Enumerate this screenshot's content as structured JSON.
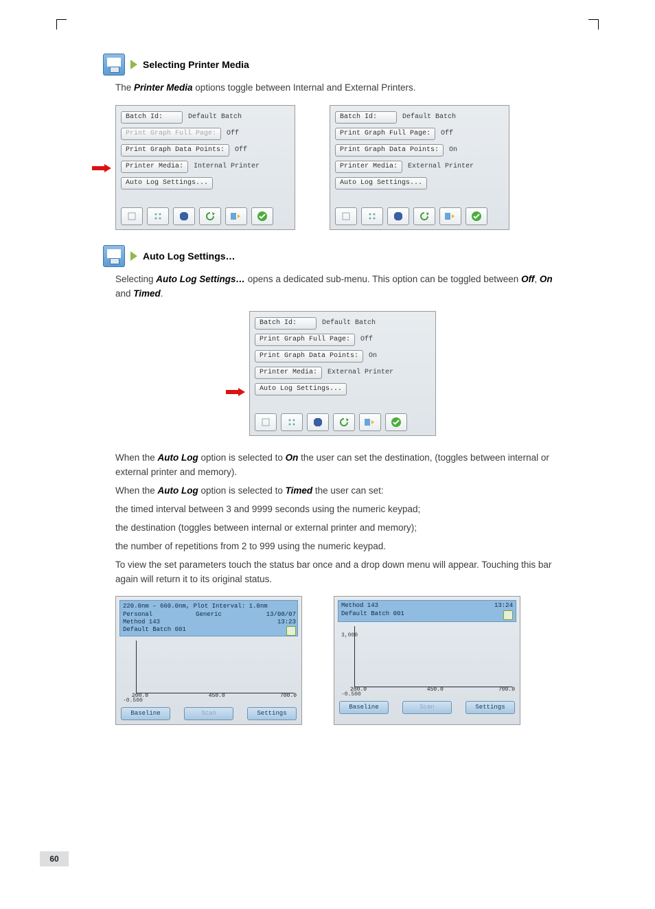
{
  "pageNumber": "60",
  "sec1": {
    "heading": "Selecting Printer Media",
    "intro_a": "The ",
    "intro_b": "Printer Media",
    "intro_c": " options toggle between Internal and External Printers."
  },
  "sec2": {
    "heading": "Auto Log Settings…",
    "intro_a": "Selecting ",
    "intro_b": "Auto Log Settings…",
    "intro_c": " opens a dedicated sub-menu. This option can be toggled between ",
    "intro_d": "Off",
    "intro_e": ", ",
    "intro_f": "On",
    "intro_g": " and ",
    "intro_h": "Timed",
    "intro_i": "."
  },
  "panelA": {
    "batchLbl": "Batch Id:",
    "batchVal": "Default Batch",
    "fullLbl": "Print Graph Full Page:",
    "fullVal": "Off",
    "ptsLbl": "Print Graph Data Points:",
    "ptsVal": "Off",
    "mediaLbl": "Printer Media:",
    "mediaVal": "Internal Printer",
    "autoLbl": "Auto Log Settings..."
  },
  "panelB": {
    "batchLbl": "Batch Id:",
    "batchVal": "Default Batch",
    "fullLbl": "Print Graph Full Page:",
    "fullVal": "Off",
    "ptsLbl": "Print Graph Data Points:",
    "ptsVal": "On",
    "mediaLbl": "Printer Media:",
    "mediaVal": "External Printer",
    "autoLbl": "Auto Log Settings..."
  },
  "panelC": {
    "batchLbl": "Batch Id:",
    "batchVal": "Default Batch",
    "fullLbl": "Print Graph Full Page:",
    "fullVal": "Off",
    "ptsLbl": "Print Graph Data Points:",
    "ptsVal": "On",
    "mediaLbl": "Printer Media:",
    "mediaVal": "External Printer",
    "autoLbl": "Auto Log Settings..."
  },
  "para": {
    "p1a": "When the ",
    "p1b": "Auto Log",
    "p1c": " option is selected to ",
    "p1d": "On",
    "p1e": " the user can set the destination, (toggles between internal or external printer and memory).",
    "p2a": "When the ",
    "p2b": "Auto Log",
    "p2c": " option is selected to ",
    "p2d": "Timed",
    "p2e": " the user can set:",
    "p3": "the timed interval between 3 and 9999 seconds using the numeric keypad;",
    "p4": "the destination (toggles between internal or external printer and memory);",
    "p5": "the number of repetitions from 2 to 999 using the numeric keypad.",
    "p6": "To view the set parameters touch the status bar once and a drop down menu will appear. Touching this bar again will return it to its original status."
  },
  "graphA": {
    "line1": "220.0nm – 660.0nm, Plot Interval: 1.0nm",
    "line2a": "Personal",
    "line2b": "Generic",
    "line3": "Method 143",
    "line4": "Default Batch 001",
    "date": "13/08/07",
    "time": "13:23",
    "yTop": "",
    "yBot": "-0.500",
    "x1": "200.0",
    "x2": "450.0",
    "x3": "700.0",
    "btn1": "Baseline",
    "btn2": "Scan",
    "btn3": "Settings"
  },
  "graphB": {
    "line1": "Method 143",
    "time": "13:24",
    "line2": "Default Batch 001",
    "yTop": "3,000",
    "yBot": "-0.500",
    "x1": "200.0",
    "x2": "450.0",
    "x3": "700.0",
    "btn1": "Baseline",
    "btn2": "Scan",
    "btn3": "Settings"
  },
  "chart_data": [
    {
      "type": "line",
      "title": "Scan A",
      "series": [],
      "x": [
        200.0,
        450.0,
        700.0
      ],
      "xlabel": "nm",
      "ylabel": "",
      "ylim": [
        -0.5,
        3.0
      ],
      "xlim": [
        200,
        700
      ]
    },
    {
      "type": "line",
      "title": "Scan B",
      "series": [],
      "x": [
        200.0,
        450.0,
        700.0
      ],
      "xlabel": "nm",
      "ylabel": "",
      "ylim": [
        -0.5,
        3.0
      ],
      "xlim": [
        200,
        700
      ]
    }
  ]
}
